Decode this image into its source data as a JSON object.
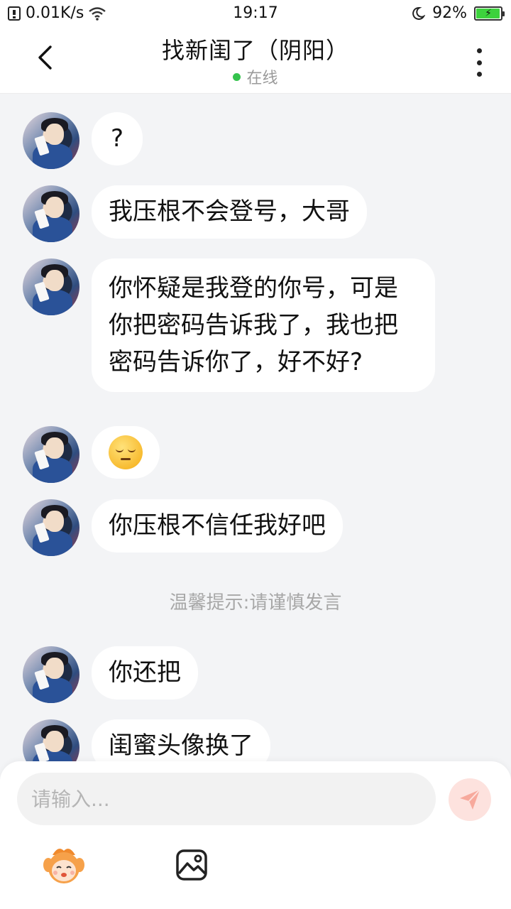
{
  "status_bar": {
    "network_speed": "0.01K/s",
    "time": "19:17",
    "battery": "92%"
  },
  "header": {
    "title": "找新闺了（阴阳）",
    "status": "在线"
  },
  "messages": [
    {
      "text": "?"
    },
    {
      "text": "我压根不会登号，大哥"
    },
    {
      "text": "你怀疑是我登的你号，可是你把密码告诉我了，我也把密码告诉你了，好不好?"
    },
    {
      "emoji": "pensive-face-emoji"
    },
    {
      "text": "你压根不信任我好吧"
    },
    {
      "text": "你还把"
    },
    {
      "text": "闺蜜头像换了"
    }
  ],
  "system_tip": "温馨提示:请谨慎发言",
  "composer": {
    "placeholder": "请输入..."
  },
  "colors": {
    "online_dot": "#35c34d",
    "send_button": "#fde2de",
    "send_icon": "#f7a99c",
    "battery_fill": "#3dd23d"
  }
}
